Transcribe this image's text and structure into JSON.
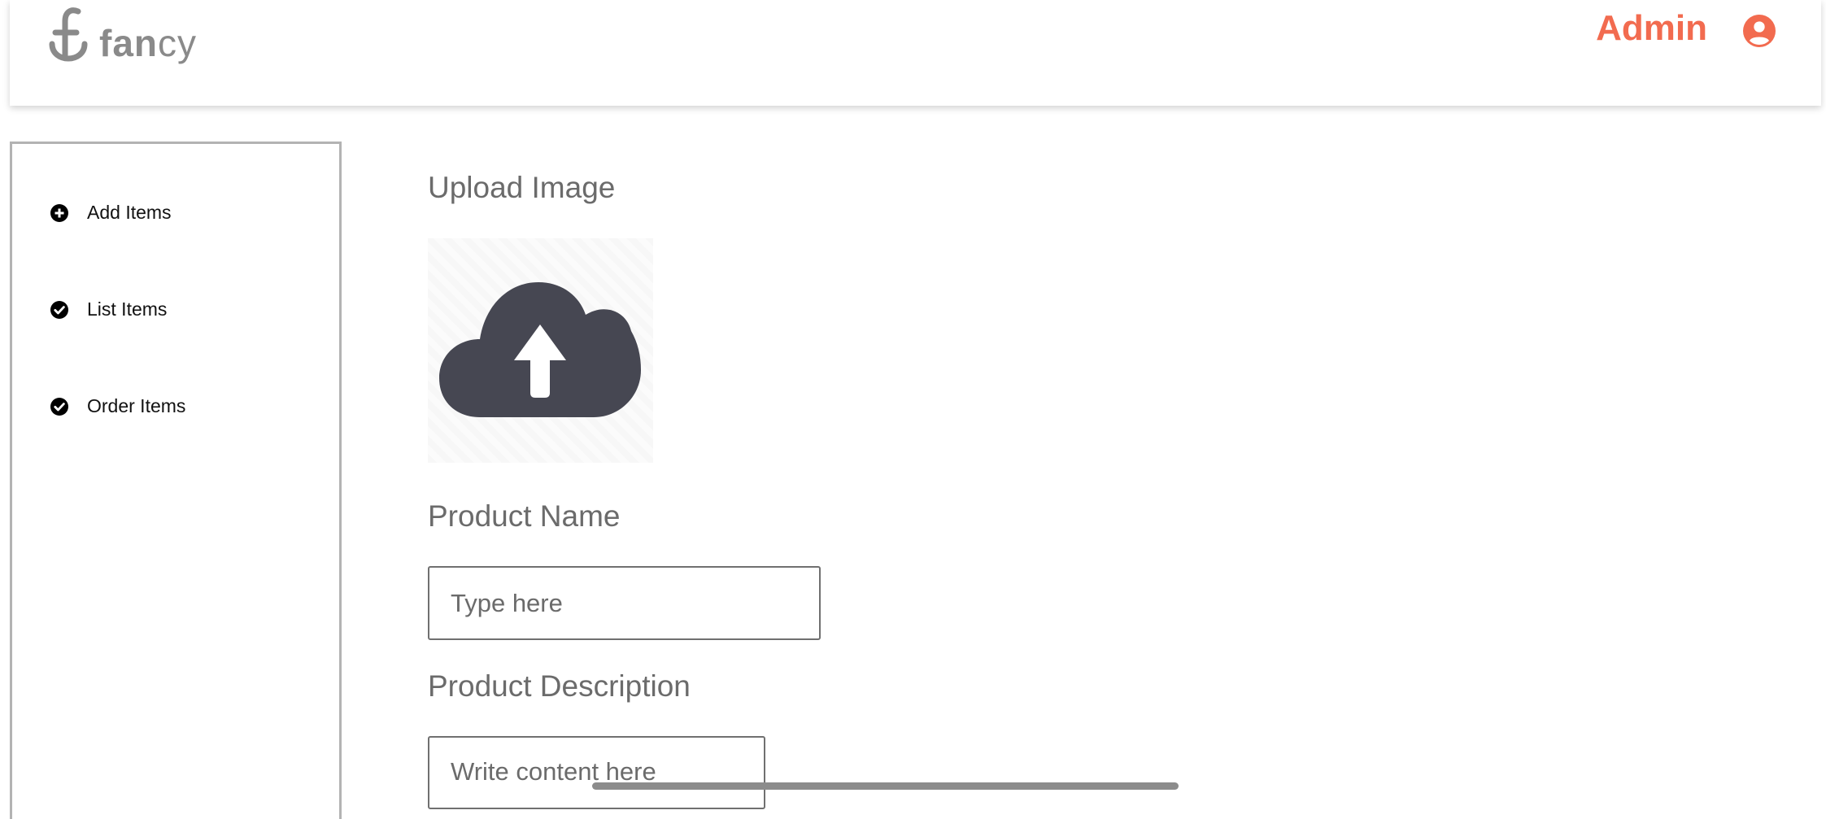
{
  "brand": {
    "logo_text_bold": "fan",
    "logo_text_light": "cy",
    "logo_color": "#8a8a8a"
  },
  "header": {
    "user_label": "Admin",
    "user_icon": "account-circle-icon",
    "accent_color": "#f26b4f"
  },
  "sidebar": {
    "items": [
      {
        "label": "Add Items",
        "icon": "plus-circle-icon"
      },
      {
        "label": "List Items",
        "icon": "check-circle-icon"
      },
      {
        "label": "Order Items",
        "icon": "check-circle-icon"
      }
    ]
  },
  "form": {
    "upload_label": "Upload Image",
    "upload_icon": "cloud-upload-icon",
    "name_label": "Product Name",
    "name_placeholder": "Type here",
    "description_label": "Product Description",
    "description_placeholder": "Write content here"
  }
}
